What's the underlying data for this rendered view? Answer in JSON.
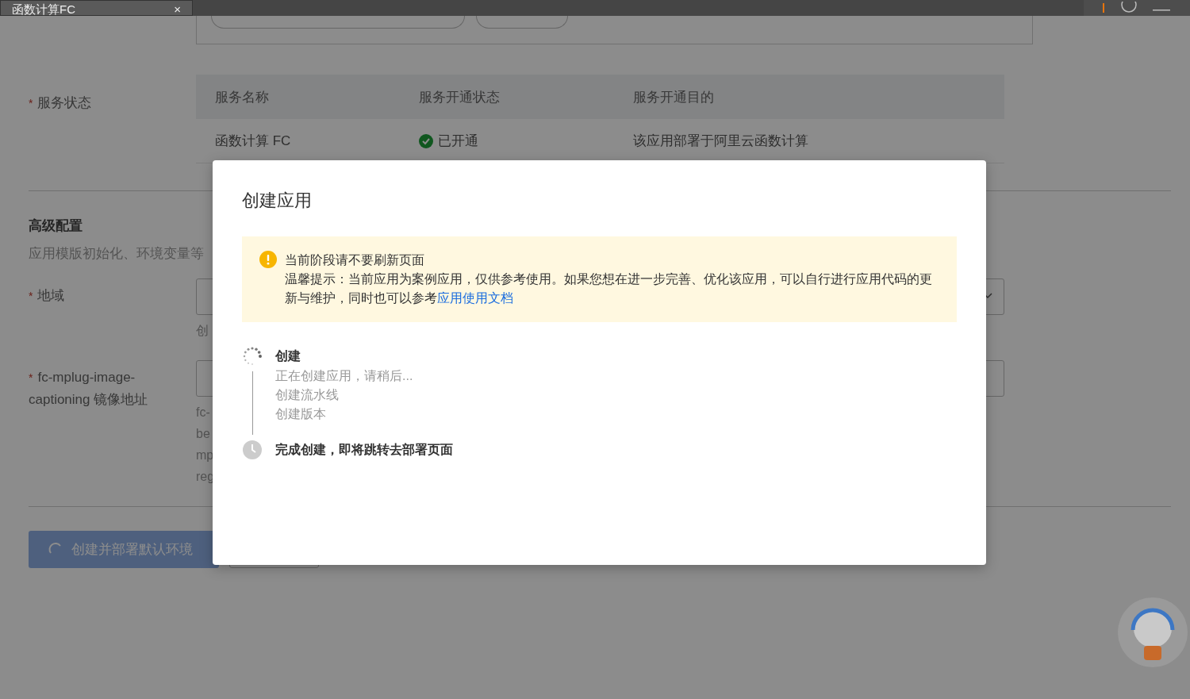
{
  "browser_tab": {
    "title": "函数计算FC",
    "close": "×"
  },
  "policies": {
    "chips": [
      {
        "kind": "policy"
      },
      {
        "kind": "add"
      }
    ]
  },
  "service_status": {
    "label": "服务状态",
    "required_mark": "*",
    "columns": [
      "服务名称",
      "服务开通状态",
      "服务开通目的"
    ],
    "rows": [
      {
        "name": "函数计算 FC",
        "kind": "enabled",
        "status_text": "已开通",
        "purpose": "该应用部署于阿里云函数计算"
      }
    ]
  },
  "advanced": {
    "title": "高级配置",
    "description": "应用模版初始化、环境变量等"
  },
  "fields": [
    {
      "label": "地域",
      "required_mark": "*",
      "kind": "select",
      "help": [
        "创"
      ]
    },
    {
      "label": "fc-mplug-image-captioning 镜像地址",
      "required_mark": "*",
      "kind": "text",
      "help": [
        "fc-",
        "be",
        "mp",
        "reg"
      ]
    }
  ],
  "actions": {
    "primary": {
      "label": "创建并部署默认环境",
      "loading": true,
      "disabled": true
    }
  },
  "dialog": {
    "title": "创建应用",
    "alert": {
      "kind": "warning",
      "title": "当前阶段请不要刷新页面",
      "text": "温馨提示：当前应用为案例应用，仅供参考使用。如果您想在进一步完善、优化该应用，可以自行进行应用代码的更新与维护，同时也可以参考",
      "link": "应用使用文档"
    },
    "steps": [
      {
        "title": "创建",
        "kind": "process",
        "lines": [
          "正在创建应用，请稍后...",
          "创建流水线",
          "创建版本"
        ]
      },
      {
        "title": "完成创建，即将跳转去部署页面",
        "kind": "wait"
      }
    ]
  }
}
